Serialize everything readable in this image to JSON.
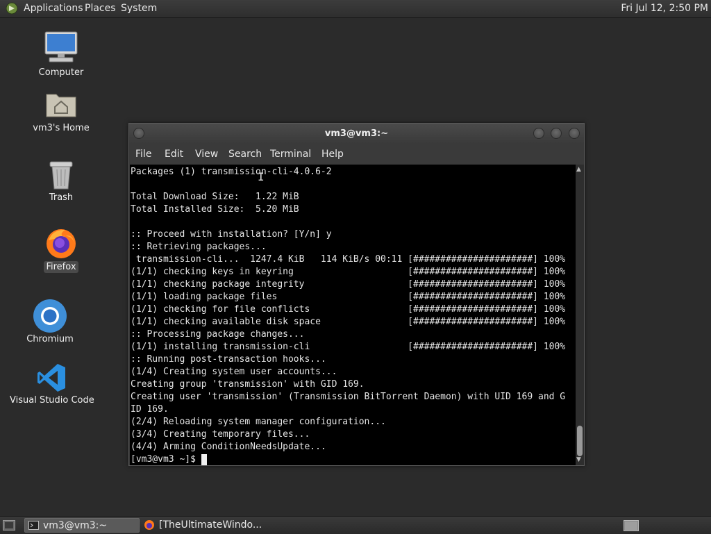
{
  "top_panel": {
    "menus": [
      "Applications",
      "Places",
      "System"
    ],
    "clock": "Fri Jul 12,  2:50 PM"
  },
  "desktop": {
    "icons": [
      {
        "label": "Computer",
        "icon": "computer-icon"
      },
      {
        "label": "vm3's Home",
        "icon": "home-folder-icon"
      },
      {
        "label": "Trash",
        "icon": "trash-icon"
      },
      {
        "label": "Firefox",
        "icon": "firefox-icon"
      },
      {
        "label": "Chromium",
        "icon": "chromium-icon"
      },
      {
        "label": "Visual Studio Code",
        "icon": "vscode-icon"
      }
    ]
  },
  "terminal": {
    "title": "vm3@vm3:~",
    "menu": [
      "File",
      "Edit",
      "View",
      "Search",
      "Terminal",
      "Help"
    ],
    "lines": [
      "Packages (1) transmission-cli-4.0.6-2",
      "",
      "Total Download Size:   1.22 MiB",
      "Total Installed Size:  5.20 MiB",
      "",
      ":: Proceed with installation? [Y/n] y",
      ":: Retrieving packages...",
      " transmission-cli...  1247.4 KiB   114 KiB/s 00:11 [######################] 100%",
      "(1/1) checking keys in keyring                     [######################] 100%",
      "(1/1) checking package integrity                   [######################] 100%",
      "(1/1) loading package files                        [######################] 100%",
      "(1/1) checking for file conflicts                  [######################] 100%",
      "(1/1) checking available disk space                [######################] 100%",
      ":: Processing package changes...",
      "(1/1) installing transmission-cli                  [######################] 100%",
      ":: Running post-transaction hooks...",
      "(1/4) Creating system user accounts...",
      "Creating group 'transmission' with GID 169.",
      "Creating user 'transmission' (Transmission BitTorrent Daemon) with UID 169 and G",
      "ID 169.",
      "(2/4) Reloading system manager configuration...",
      "(3/4) Creating temporary files...",
      "(4/4) Arming ConditionNeedsUpdate...",
      "[vm3@vm3 ~]$ "
    ]
  },
  "taskbar": {
    "tasks": [
      {
        "label": "vm3@vm3:~",
        "icon": "terminal-icon",
        "active": true
      },
      {
        "label": "[TheUltimateWindo...",
        "icon": "firefox-icon",
        "active": false
      }
    ]
  }
}
